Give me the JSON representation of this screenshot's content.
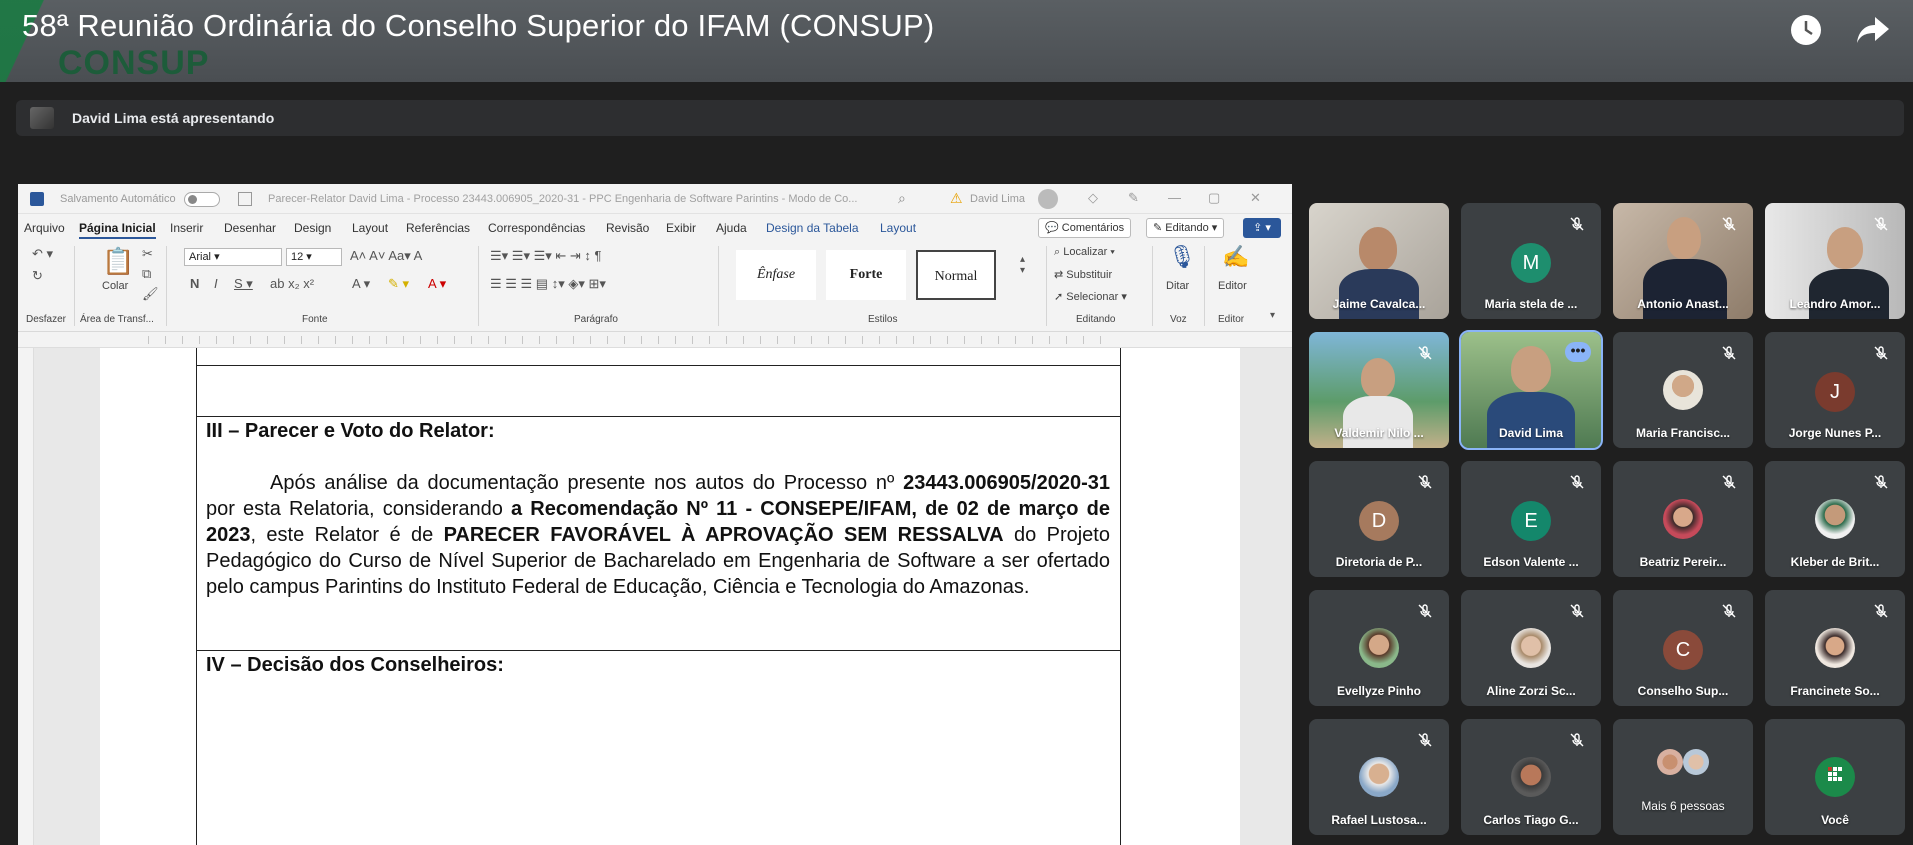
{
  "video": {
    "title": "58ª Reunião Ordinária do Conselho Superior do IFAM (CONSUP)",
    "logo_text": "CONSUP"
  },
  "presenting": {
    "text": "David Lima está apresentando"
  },
  "word": {
    "autosave": "Salvamento Automático",
    "docname": "Parecer-Relator David Lima - Processo 23443.006905_2020-31 - PPC Engenharia de Software Parintins - Modo de Co...",
    "user": "David Lima",
    "menu": [
      "Arquivo",
      "Página Inicial",
      "Inserir",
      "Desenhar",
      "Design",
      "Layout",
      "Referências",
      "Correspondências",
      "Revisão",
      "Exibir",
      "Ajuda",
      "Design da Tabela",
      "Layout"
    ],
    "comments_btn": "Comentários",
    "editing_btn": "Editando",
    "ribbon": {
      "undo_label": "Desfazer",
      "clipboard_label": "Área de Transf...",
      "paste_label": "Colar",
      "font_name": "Arial",
      "font_size": "12",
      "font_label": "Fonte",
      "paragraph_label": "Parágrafo",
      "styles_label": "Estilos",
      "style_enfase": "Ênfase",
      "style_forte": "Forte",
      "style_normal": "Normal",
      "find": "Localizar",
      "replace": "Substituir",
      "select": "Selecionar",
      "editing_label": "Editando",
      "dictate": "Ditar",
      "voice_label": "Voz",
      "editor": "Editor",
      "editor_label": "Editor"
    },
    "document": {
      "heading3": "III – Parecer e Voto do Relator:",
      "p_part1": "Após análise da documentação presente nos autos do Processo nº ",
      "p_bold1": "23443.006905/2020-31",
      "p_part2": " por esta Relatoria, considerando ",
      "p_bold2": "a Recomendação Nº 11 - CONSEPE/IFAM, de 02 de março de 2023",
      "p_part3": ", este Relator é de ",
      "p_bold3": "PARECER FAVORÁVEL À APROVAÇÃO SEM RESSALVA",
      "p_part4": " do Projeto Pedagógico do Curso de Nível Superior de Bacharelado em Engenharia de Software a ser ofertado pelo campus Parintins do Instituto Federal de Educação, Ciência e Tecnologia do Amazonas.",
      "heading4": "IV – Decisão dos Conselheiros:"
    }
  },
  "participants": [
    {
      "name": "Jaime Cavalca..."
    },
    {
      "name": "Maria stela de ...",
      "initial": "M",
      "color": "#1e8e6e"
    },
    {
      "name": "Antonio Anast..."
    },
    {
      "name": "Leandro Amor..."
    },
    {
      "name": "Valdemir Nilo ..."
    },
    {
      "name": "David Lima"
    },
    {
      "name": "Maria Francisc..."
    },
    {
      "name": "Jorge Nunes P...",
      "initial": "J",
      "color": "#7a3b2e"
    },
    {
      "name": "Diretoria de P...",
      "initial": "D",
      "color": "#a67a5e"
    },
    {
      "name": "Edson Valente ...",
      "initial": "E",
      "color": "#14876b"
    },
    {
      "name": "Beatriz Pereir..."
    },
    {
      "name": "Kleber de Brit..."
    },
    {
      "name": "Evellyze Pinho"
    },
    {
      "name": "Aline Zorzi Sc..."
    },
    {
      "name": "Conselho Sup...",
      "initial": "C",
      "color": "#8a4a3a"
    },
    {
      "name": "Francinete So..."
    },
    {
      "name": "Rafael Lustosa..."
    },
    {
      "name": "Carlos Tiago G..."
    },
    {
      "name": "Mais 6 pessoas"
    },
    {
      "name": "Você"
    }
  ],
  "colors": {
    "accent": "#8ab4f8",
    "tile_bg": "#3c4043",
    "word_blue": "#2b579a"
  }
}
